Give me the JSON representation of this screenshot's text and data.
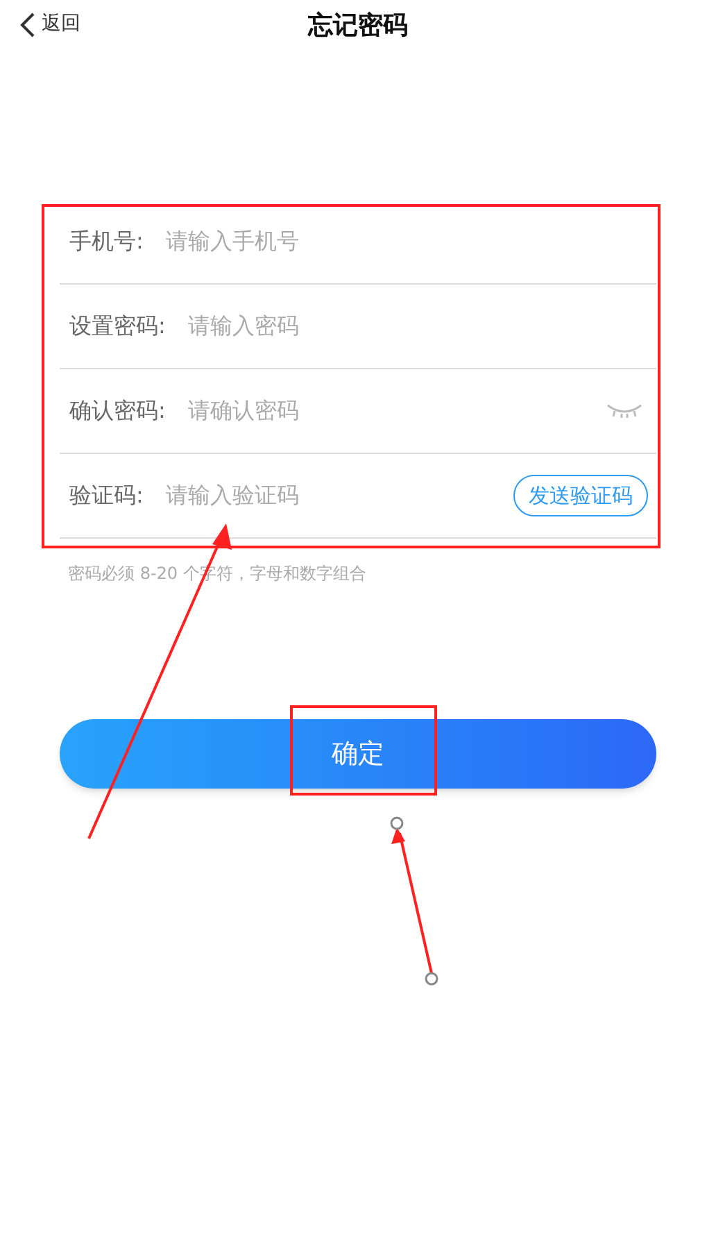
{
  "header": {
    "back": "返回",
    "title": "忘记密码"
  },
  "fields": [
    {
      "kind": "text",
      "label": "手机号:",
      "placeholder": "请输入手机号"
    },
    {
      "kind": "text",
      "label": "设置密码:",
      "placeholder": "请输入密码"
    },
    {
      "kind": "password",
      "label": "确认密码:",
      "placeholder": "请确认密码"
    },
    {
      "kind": "code",
      "label": "验证码:",
      "placeholder": "请输入验证码",
      "action": "发送验证码"
    }
  ],
  "hint": "密码必须 8-20 个字符，字母和数字组合",
  "submit": "确定"
}
